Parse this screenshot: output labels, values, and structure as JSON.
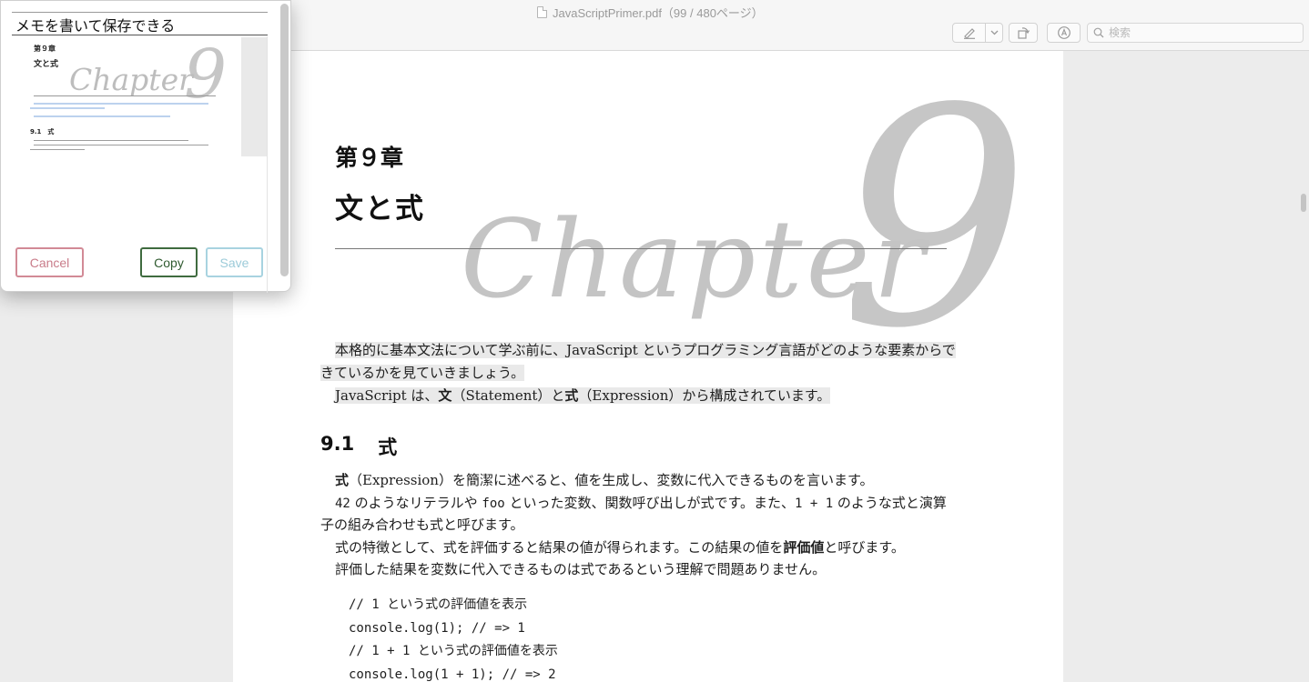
{
  "window": {
    "doc_title": "JavaScriptPrimer.pdf（99 / 480ページ）"
  },
  "toolbar": {
    "search_placeholder": "検索",
    "icons": [
      "markup-pen-icon",
      "chevron-down-icon",
      "rotate-icon",
      "annotate-icon",
      "search-icon"
    ]
  },
  "page": {
    "chapter_number": "第９章",
    "chapter_title": "文と式",
    "chapter_word": "Chapter",
    "chapter_digit": "9",
    "intro_line1": "本格的に基本文法について学ぶ前に、JavaScript というプログラミング言語がどのような要素からで",
    "intro_line2": "きているかを見ていきましょう。",
    "intro2_pre": "JavaScript は、",
    "intro2_bold1": "文",
    "intro2_mid": "（Statement）と",
    "intro2_bold2": "式",
    "intro2_post": "（Expression）から構成されています。",
    "section_number": "9.1",
    "section_title": "式",
    "p1_bold": "式",
    "p1_rest": "（Expression）を簡潔に述べると、値を生成し、変数に代入できるものを言います。",
    "p2_a": "42",
    "p2_b": " のようなリテラルや ",
    "p2_c": "foo",
    "p2_d": " といった変数、関数呼び出しが式です。また、",
    "p2_e": "1 + 1",
    "p2_f": " のような式と演算",
    "p2_line2": "子の組み合わせも式と呼びます。",
    "p3_pre": "式の特徴として、式を評価すると結果の値が得られます。この結果の値を",
    "p3_bold": "評価値",
    "p3_post": "と呼びます。",
    "p4": "評価した結果を変数に代入できるものは式であるという理解で問題ありません。",
    "code": [
      "// 1 という式の評価値を表示",
      "console.log(1); // => 1",
      "// 1 + 1 という式の評価値を表示",
      "console.log(1 + 1); // => 2"
    ]
  },
  "memo": {
    "input_value": "メモを書いて保存できる",
    "thumb_chapter_number": "第９章",
    "thumb_chapter_title": "文と式",
    "thumb_chapter_word": "Chapter",
    "thumb_chapter_digit": "9",
    "thumb_section": "9.1　式",
    "cancel_label": "Cancel",
    "copy_label": "Copy",
    "save_label": "Save"
  },
  "colors": {
    "cancel": "#d28a96",
    "copy": "#3f6b3f",
    "save": "#a8d3e0",
    "highlight": "#e9e9e9"
  }
}
